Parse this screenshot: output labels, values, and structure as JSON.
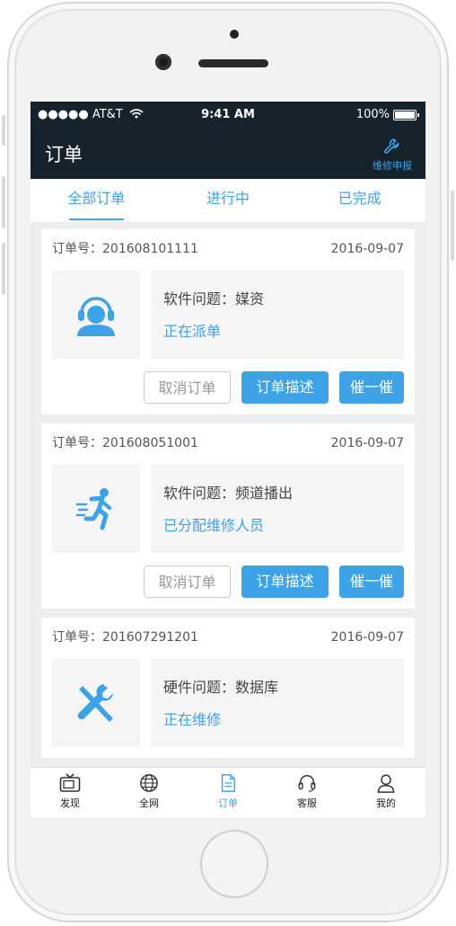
{
  "status_bar": {
    "carrier": "●●●●● AT&T",
    "time": "9:41 AM",
    "battery": "100%"
  },
  "nav": {
    "title": "订单",
    "action_label": "维修申报",
    "action_icon": "wrench-icon"
  },
  "tabs": [
    {
      "label": "全部订单",
      "active": true
    },
    {
      "label": "进行中",
      "active": false
    },
    {
      "label": "已完成",
      "active": false
    }
  ],
  "orders": [
    {
      "order_no": "订单号：201608101111",
      "date": "2016-09-07",
      "icon": "headset-person-icon",
      "problem": "软件问题：媒资",
      "status": "正在派单",
      "cancel_label": "取消订单",
      "describe_label": "订单描述",
      "urge_label": "催一催"
    },
    {
      "order_no": "订单号：201608051001",
      "date": "2016-09-07",
      "icon": "running-person-icon",
      "problem": "软件问题：频道播出",
      "status": "已分配维修人员",
      "cancel_label": "取消订单",
      "describe_label": "订单描述",
      "urge_label": "催一催"
    },
    {
      "order_no": "订单号：201607291201",
      "date": "2016-09-07",
      "icon": "tools-icon",
      "problem": "硬件问题：数据库",
      "status": "正在维修"
    }
  ],
  "tabbar": [
    {
      "label": "发现",
      "icon": "tv-icon",
      "active": false
    },
    {
      "label": "全网",
      "icon": "globe-icon",
      "active": false
    },
    {
      "label": "订单",
      "icon": "document-icon",
      "active": true
    },
    {
      "label": "客服",
      "icon": "headset-icon",
      "active": false
    },
    {
      "label": "我的",
      "icon": "user-icon",
      "active": false
    }
  ],
  "colors": {
    "accent": "#3ea2e6",
    "header": "#16222c"
  }
}
